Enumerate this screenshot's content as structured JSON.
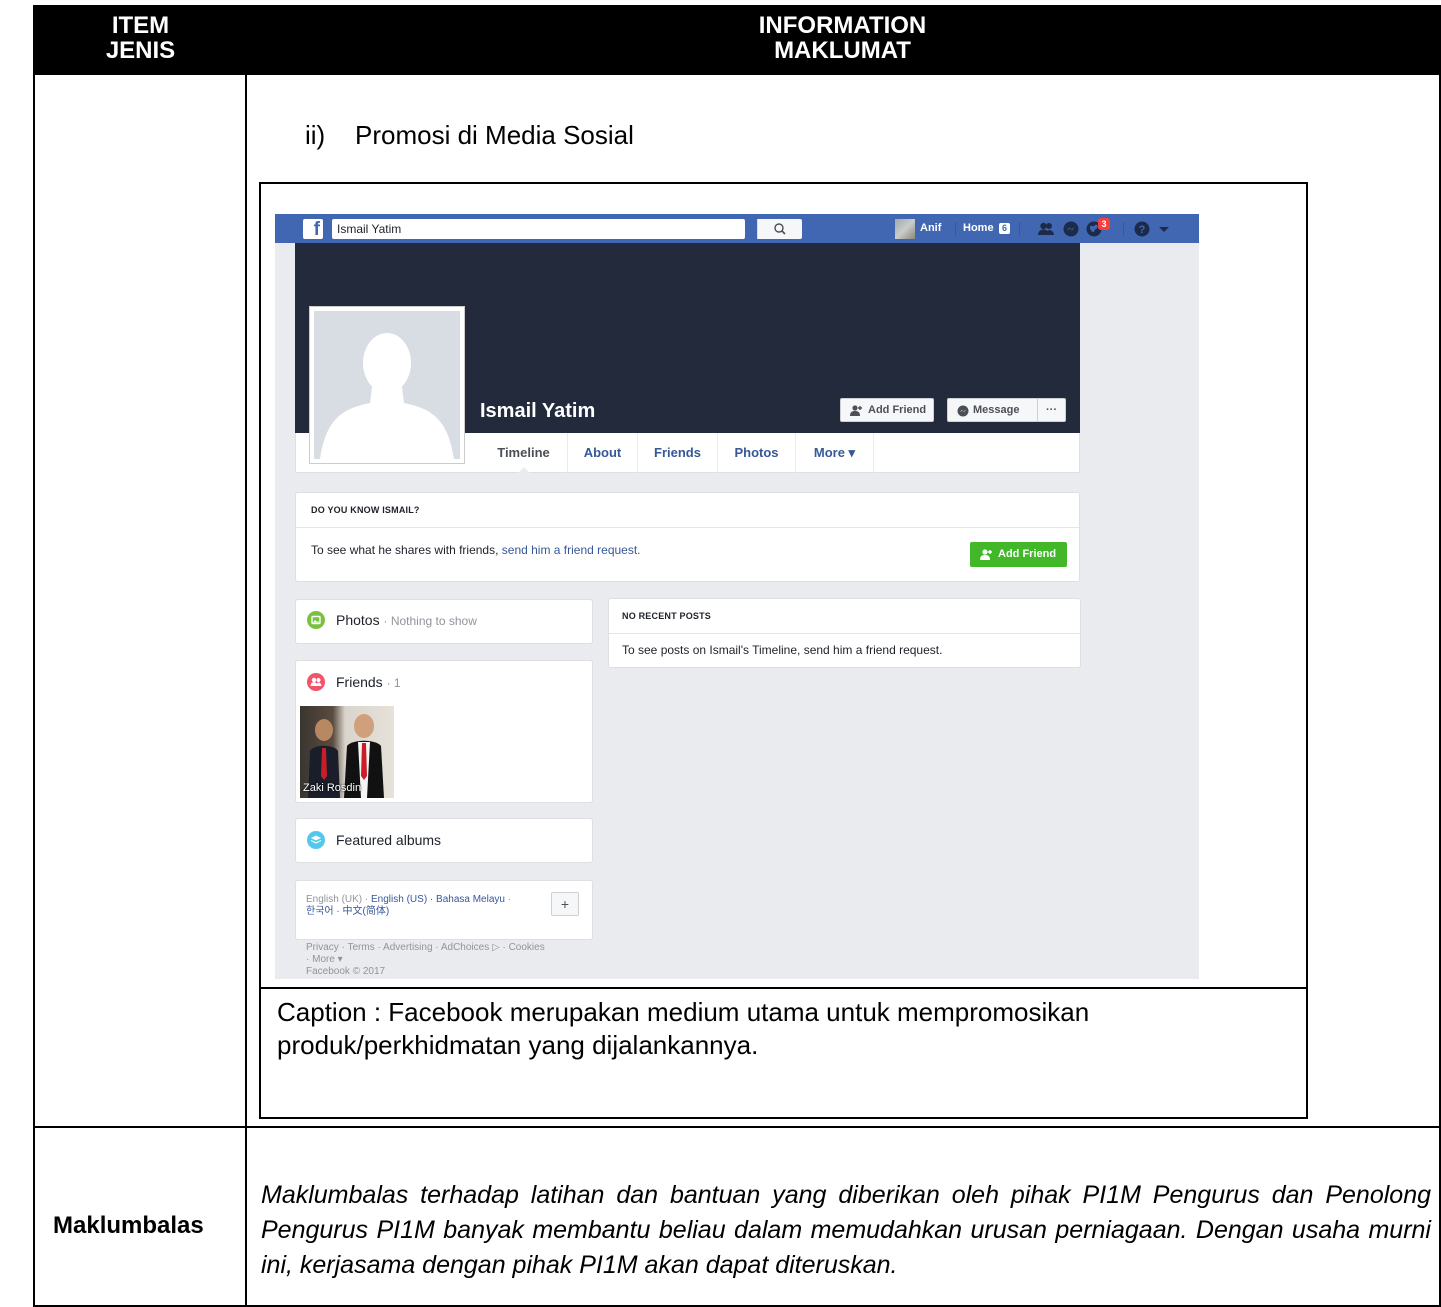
{
  "header": {
    "col1_line1": "ITEM",
    "col1_line2": "JENIS",
    "col2_line1": "INFORMATION",
    "col2_line2": "MAKLUMAT"
  },
  "section": {
    "number": "ii)",
    "title": "Promosi di Media Sosial"
  },
  "facebook": {
    "search_value": "Ismail Yatim",
    "user_name": "Anif",
    "home_label": "Home",
    "home_count": "6",
    "notification_count": "3",
    "profile_name": "Ismail Yatim",
    "add_friend_label": "Add Friend",
    "message_label": "Message",
    "more_dots": "···",
    "tabs": [
      "Timeline",
      "About",
      "Friends",
      "Photos",
      "More ▾"
    ],
    "know_card": {
      "title": "DO YOU KNOW ISMAIL?",
      "text": "To see what he shares with friends, ",
      "link": "send him a friend request.",
      "button": "Add Friend"
    },
    "photos": {
      "title": "Photos",
      "note": "· Nothing to show"
    },
    "friends": {
      "title": "Friends",
      "count": "· 1",
      "friend_name": "Zaki Rosdin"
    },
    "albums": {
      "title": "Featured albums"
    },
    "languages": {
      "line1_a": "English (UK) · ",
      "line1_b": "English (US) · Bahasa Melayu",
      "line1_c": " ·",
      "line2": "한국어 · 中文(简体)",
      "plus": "+"
    },
    "footer_links": "Privacy · Terms · Advertising · AdChoices ▷ · Cookies",
    "footer_more": "· More ▾",
    "footer_copy": "Facebook © 2017",
    "posts": {
      "title": "NO RECENT POSTS",
      "text": "To see posts on Ismail's Timeline, send him a friend request."
    },
    "colors": {
      "bar": "#4267b2",
      "cover": "#232a3b",
      "green": "#42b72a",
      "badge": "#fa3e3e"
    }
  },
  "caption": "Caption : Facebook merupakan medium utama untuk mempromosikan produk/perkhidmatan yang dijalankannya.",
  "feedback_label": "Maklumbalas",
  "feedback_text": "Maklumbalas terhadap latihan dan bantuan yang diberikan oleh pihak PI1M Pengurus dan Penolong Pengurus PI1M banyak membantu beliau dalam memudahkan urusan perniagaan. Dengan usaha murni ini, kerjasama dengan pihak PI1M akan dapat diteruskan."
}
